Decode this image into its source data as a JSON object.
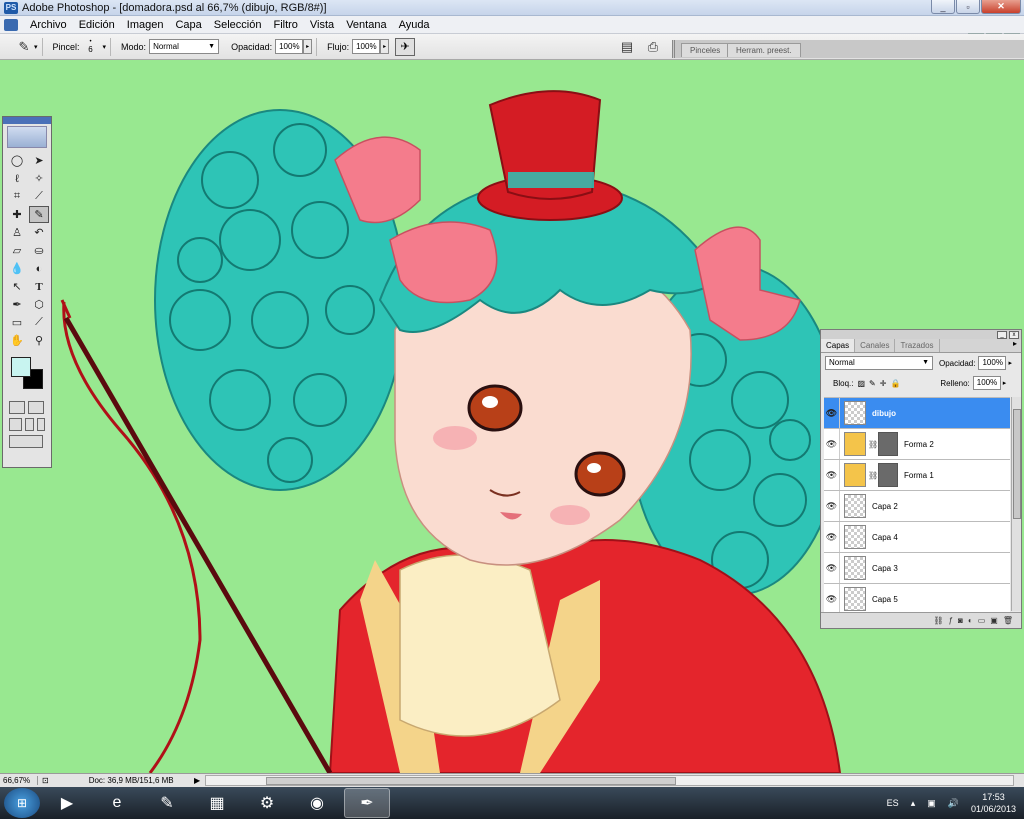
{
  "window": {
    "title": "Adobe Photoshop - [domadora.psd al 66,7% (dibujo, RGB/8#)]",
    "app_icon": "PS",
    "buttons": [
      "_",
      "▫",
      "✕"
    ]
  },
  "menus": [
    "Archivo",
    "Edición",
    "Imagen",
    "Capa",
    "Selección",
    "Filtro",
    "Vista",
    "Ventana",
    "Ayuda"
  ],
  "options": {
    "brush_label": "Pincel:",
    "brush_size": "6",
    "mode_label": "Modo:",
    "mode_value": "Normal",
    "opacity_label": "Opacidad:",
    "opacity_value": "100%",
    "flow_label": "Flujo:",
    "flow_value": "100%"
  },
  "well_tabs": [
    "Pinceles",
    "Herram. preest."
  ],
  "toolbox": {
    "tools": [
      "marquee-icon",
      "move-icon",
      "lasso-icon",
      "magic-wand-icon",
      "crop-icon",
      "slice-icon",
      "healing-icon",
      "brush-icon",
      "stamp-icon",
      "history-brush-icon",
      "eraser-icon",
      "bucket-icon",
      "blur-icon",
      "dodge-icon",
      "path-select-icon",
      "type-icon",
      "pen-icon",
      "shape-icon",
      "notes-icon",
      "eyedropper-icon",
      "hand-icon",
      "zoom-icon"
    ],
    "fg_color": "#c8f4f0",
    "bg_color": "#000000"
  },
  "layers_panel": {
    "tabs": [
      "Capas",
      "Canales",
      "Trazados"
    ],
    "blend_mode": "Normal",
    "opacity_label": "Opacidad:",
    "opacity_value": "100%",
    "lock_label": "Bloq.:",
    "fill_label": "Relleno:",
    "fill_value": "100%",
    "layers": [
      {
        "name": "dibujo",
        "selected": true,
        "type": "pixel"
      },
      {
        "name": "Forma 2",
        "selected": false,
        "type": "shape"
      },
      {
        "name": "Forma 1",
        "selected": false,
        "type": "shape"
      },
      {
        "name": "Capa 2",
        "selected": false,
        "type": "pixel"
      },
      {
        "name": "Capa 4",
        "selected": false,
        "type": "pixel"
      },
      {
        "name": "Capa 3",
        "selected": false,
        "type": "pixel"
      },
      {
        "name": "Capa 5",
        "selected": false,
        "type": "pixel"
      }
    ]
  },
  "status": {
    "zoom": "66,67%",
    "doc": "Doc: 36,9 MB/151,6 MB"
  },
  "taskbar": {
    "lang": "ES",
    "time": "17:53",
    "date": "01/06/2013"
  }
}
